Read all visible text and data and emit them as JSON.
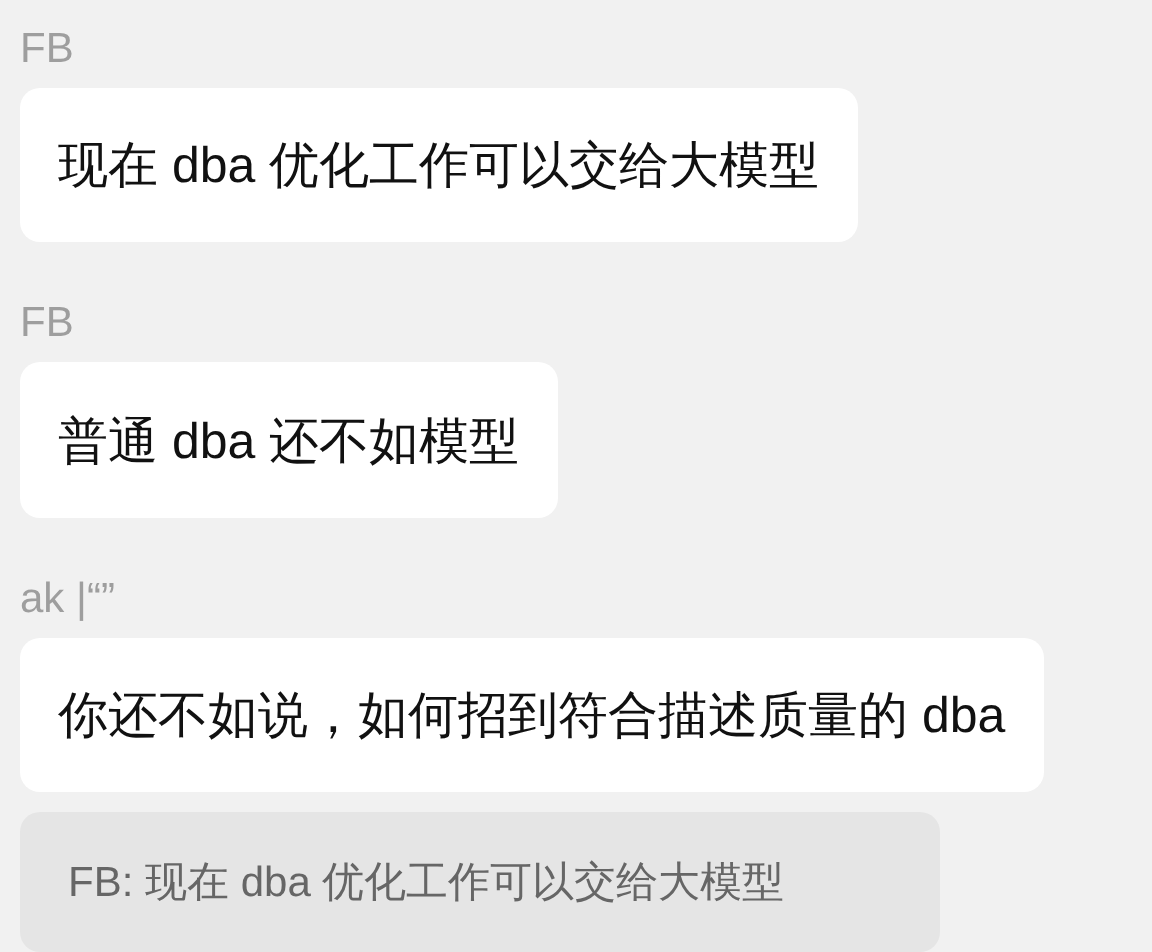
{
  "messages": [
    {
      "sender": "FB",
      "text": "现在 dba 优化工作可以交给大模型"
    },
    {
      "sender": "FB",
      "text": "普通 dba 还不如模型"
    },
    {
      "sender": "ak |“”",
      "text": "你还不如说，如何招到符合描述质量的 dba"
    }
  ],
  "quote": {
    "text": "FB: 现在 dba 优化工作可以交给大模型"
  }
}
